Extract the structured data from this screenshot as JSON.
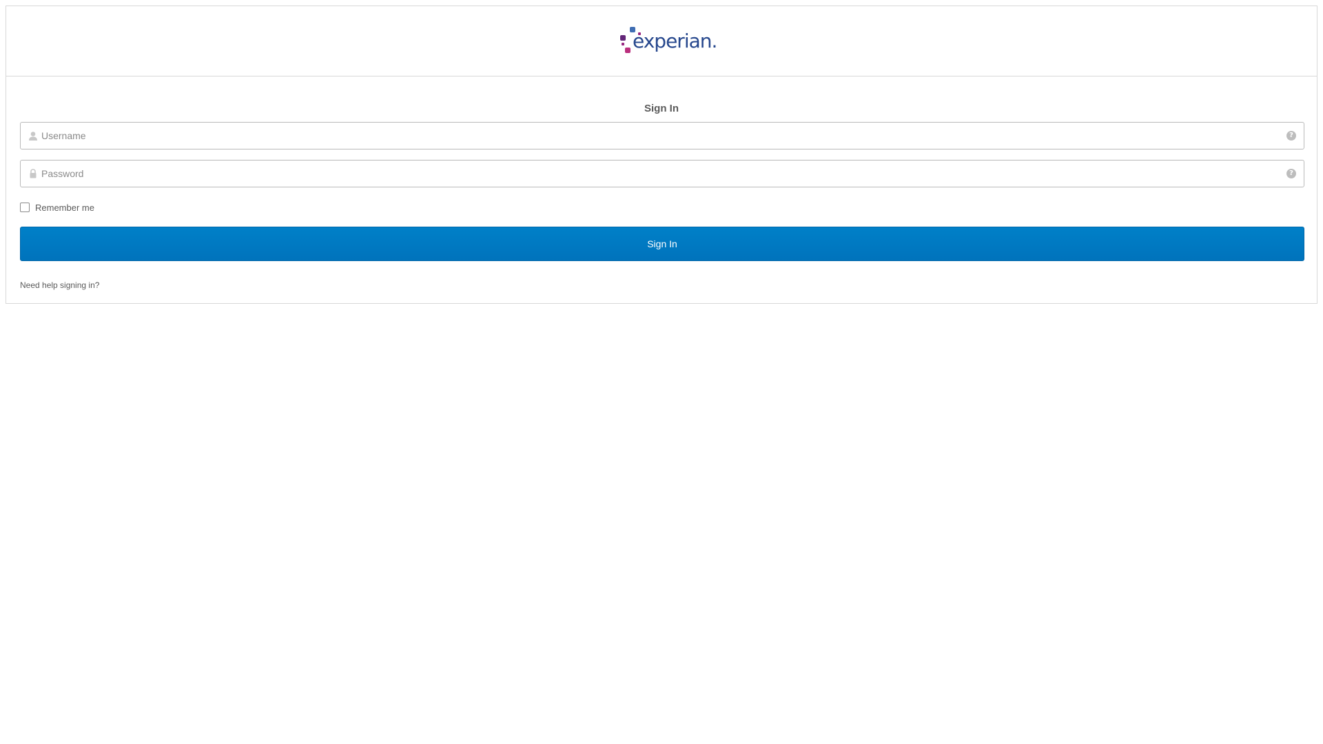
{
  "brand": {
    "name": "experian.",
    "colors": {
      "text": "#26478d",
      "dot_blue": "#406eb3",
      "dot_purple": "#632678",
      "dot_magenta": "#ba2f7d",
      "dot_violet": "#982881"
    }
  },
  "form": {
    "title": "Sign In",
    "username": {
      "placeholder": "Username",
      "icon": "user-icon",
      "help_icon": "?"
    },
    "password": {
      "placeholder": "Password",
      "icon": "lock-icon",
      "help_icon": "?"
    },
    "remember_label": "Remember me",
    "remember_checked": false,
    "submit_label": "Sign In",
    "help_link": "Need help signing in?",
    "button_color": "#0077c0"
  }
}
